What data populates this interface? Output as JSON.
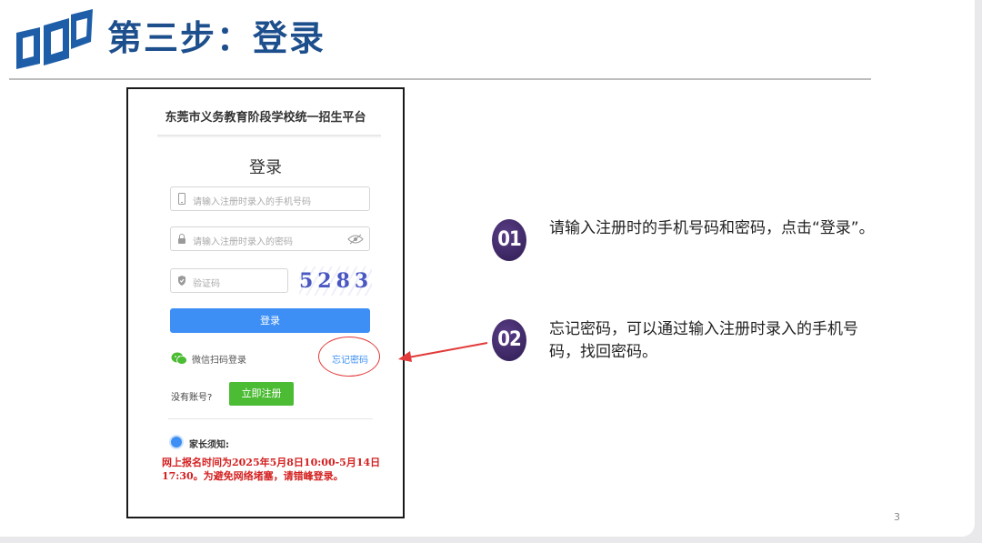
{
  "slide": {
    "title": "第三步：登录",
    "page_number": "3",
    "colors": {
      "title": "#1e4f8d",
      "badge": "#3b2766",
      "arrow": "#e23a3a"
    }
  },
  "phone": {
    "platform_name": "东莞市义务教育阶段学校统一招生平台",
    "login_heading": "登录",
    "phone_placeholder": "请输入注册时录入的手机号码",
    "password_placeholder": "请输入注册时录入的密码",
    "captcha_placeholder": "验证码",
    "captcha_text": "5283",
    "login_button": "登录",
    "wechat_login": "微信扫码登录",
    "forgot_password": "忘记密码",
    "no_account": "没有账号?",
    "register_button": "立即注册",
    "notice_title": "家长须知:",
    "notice_text": "网上报名时间为2025年5月8日10:00-5月14日17:30。为避免网络堵塞，请错峰登录。"
  },
  "steps": [
    {
      "number": "01",
      "text": "请输入注册时的手机号码和密码，点击“登录”。"
    },
    {
      "number": "02",
      "text": "忘记密码，可以通过输入注册时录入的手机号码，找回密码。"
    }
  ],
  "icons": [
    "logo-icon",
    "phone-icon",
    "lock-icon",
    "shield-icon",
    "eye-icon",
    "wechat-icon",
    "notice-icon",
    "arrow-icon"
  ]
}
